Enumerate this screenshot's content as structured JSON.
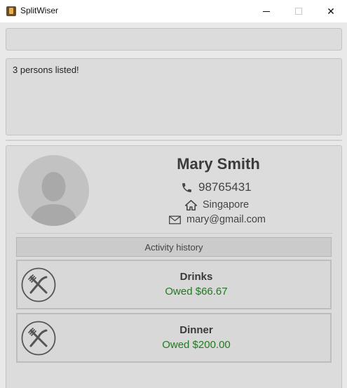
{
  "window": {
    "title": "SplitWiser",
    "minimize_symbol": "—",
    "maximize_symbol": "☐",
    "close_symbol": "✕"
  },
  "command_box": {
    "value": "",
    "placeholder": ""
  },
  "result_display": {
    "text": "3 persons listed!"
  },
  "person": {
    "name": "Mary Smith",
    "phone": "98765431",
    "address": "Singapore",
    "email": "mary@gmail.com",
    "avatar_icon": "avatar-placeholder-icon",
    "phone_icon": "phone-icon",
    "address_icon": "home-icon",
    "email_icon": "envelope-icon"
  },
  "activity_history": {
    "header": "Activity history",
    "items": [
      {
        "name": "Drinks",
        "owed": "Owed $66.67",
        "icon": "fork-knife-icon"
      },
      {
        "name": "Dinner",
        "owed": "Owed $200.00",
        "icon": "fork-knife-icon"
      }
    ]
  },
  "colors": {
    "owed_text": "#1f7a1f",
    "panel_bg": "#dcdcdc",
    "window_bg": "#e9e9e9"
  }
}
